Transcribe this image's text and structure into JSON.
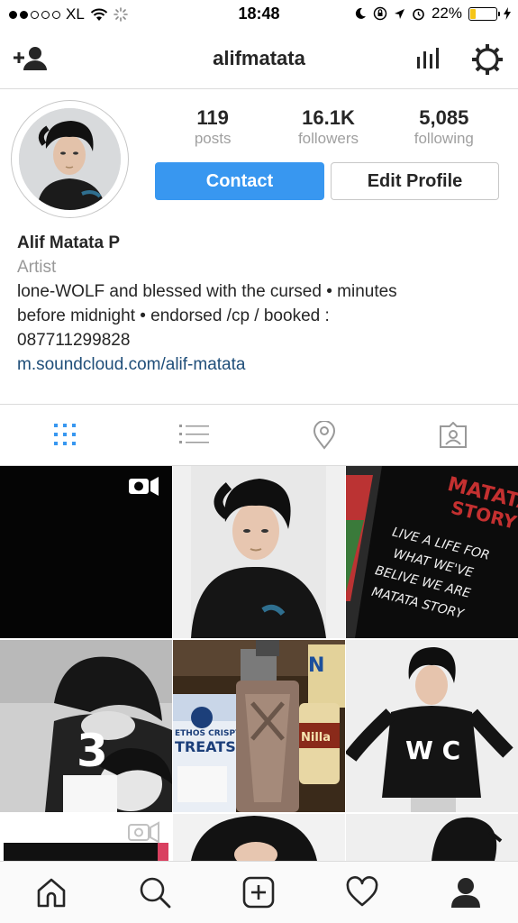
{
  "status_bar": {
    "carrier": "XL",
    "time": "18:48",
    "battery_percent": "22%",
    "battery_level": 0.22
  },
  "header": {
    "username": "alifmatata"
  },
  "profile": {
    "posts_count": "119",
    "posts_label": "posts",
    "followers_count": "16.1K",
    "followers_label": "followers",
    "following_count": "5,085",
    "following_label": "following",
    "contact_label": "Contact",
    "edit_label": "Edit Profile",
    "name": "Alif Matata P",
    "category": "Artist",
    "bio_line1": "lone-WOLF and blessed with the cursed • minutes",
    "bio_line2": "before midnight • endorsed /cp / booked :",
    "bio_line3": "087711299828",
    "link": "m.soundcloud.com/alif-matata"
  },
  "tabs": [
    "grid-icon",
    "list-icon",
    "location-icon",
    "tagged-icon"
  ],
  "grid_text": {
    "shirt_top": "MATATA",
    "shirt_top2": "STORY",
    "shirt_l1": "LIVE A LIFE FOR",
    "shirt_l2": "WHAT WE'VE",
    "shirt_l3": "BELIVE WE ARE",
    "shirt_l4": "MATATA STORY",
    "shirt_wc": "W C",
    "box_top": "ETHOS CRISPY",
    "box_main": "TREATS",
    "bottle": "Nilla"
  },
  "colors": {
    "accent": "#3897f0",
    "link": "#1f4e79"
  }
}
